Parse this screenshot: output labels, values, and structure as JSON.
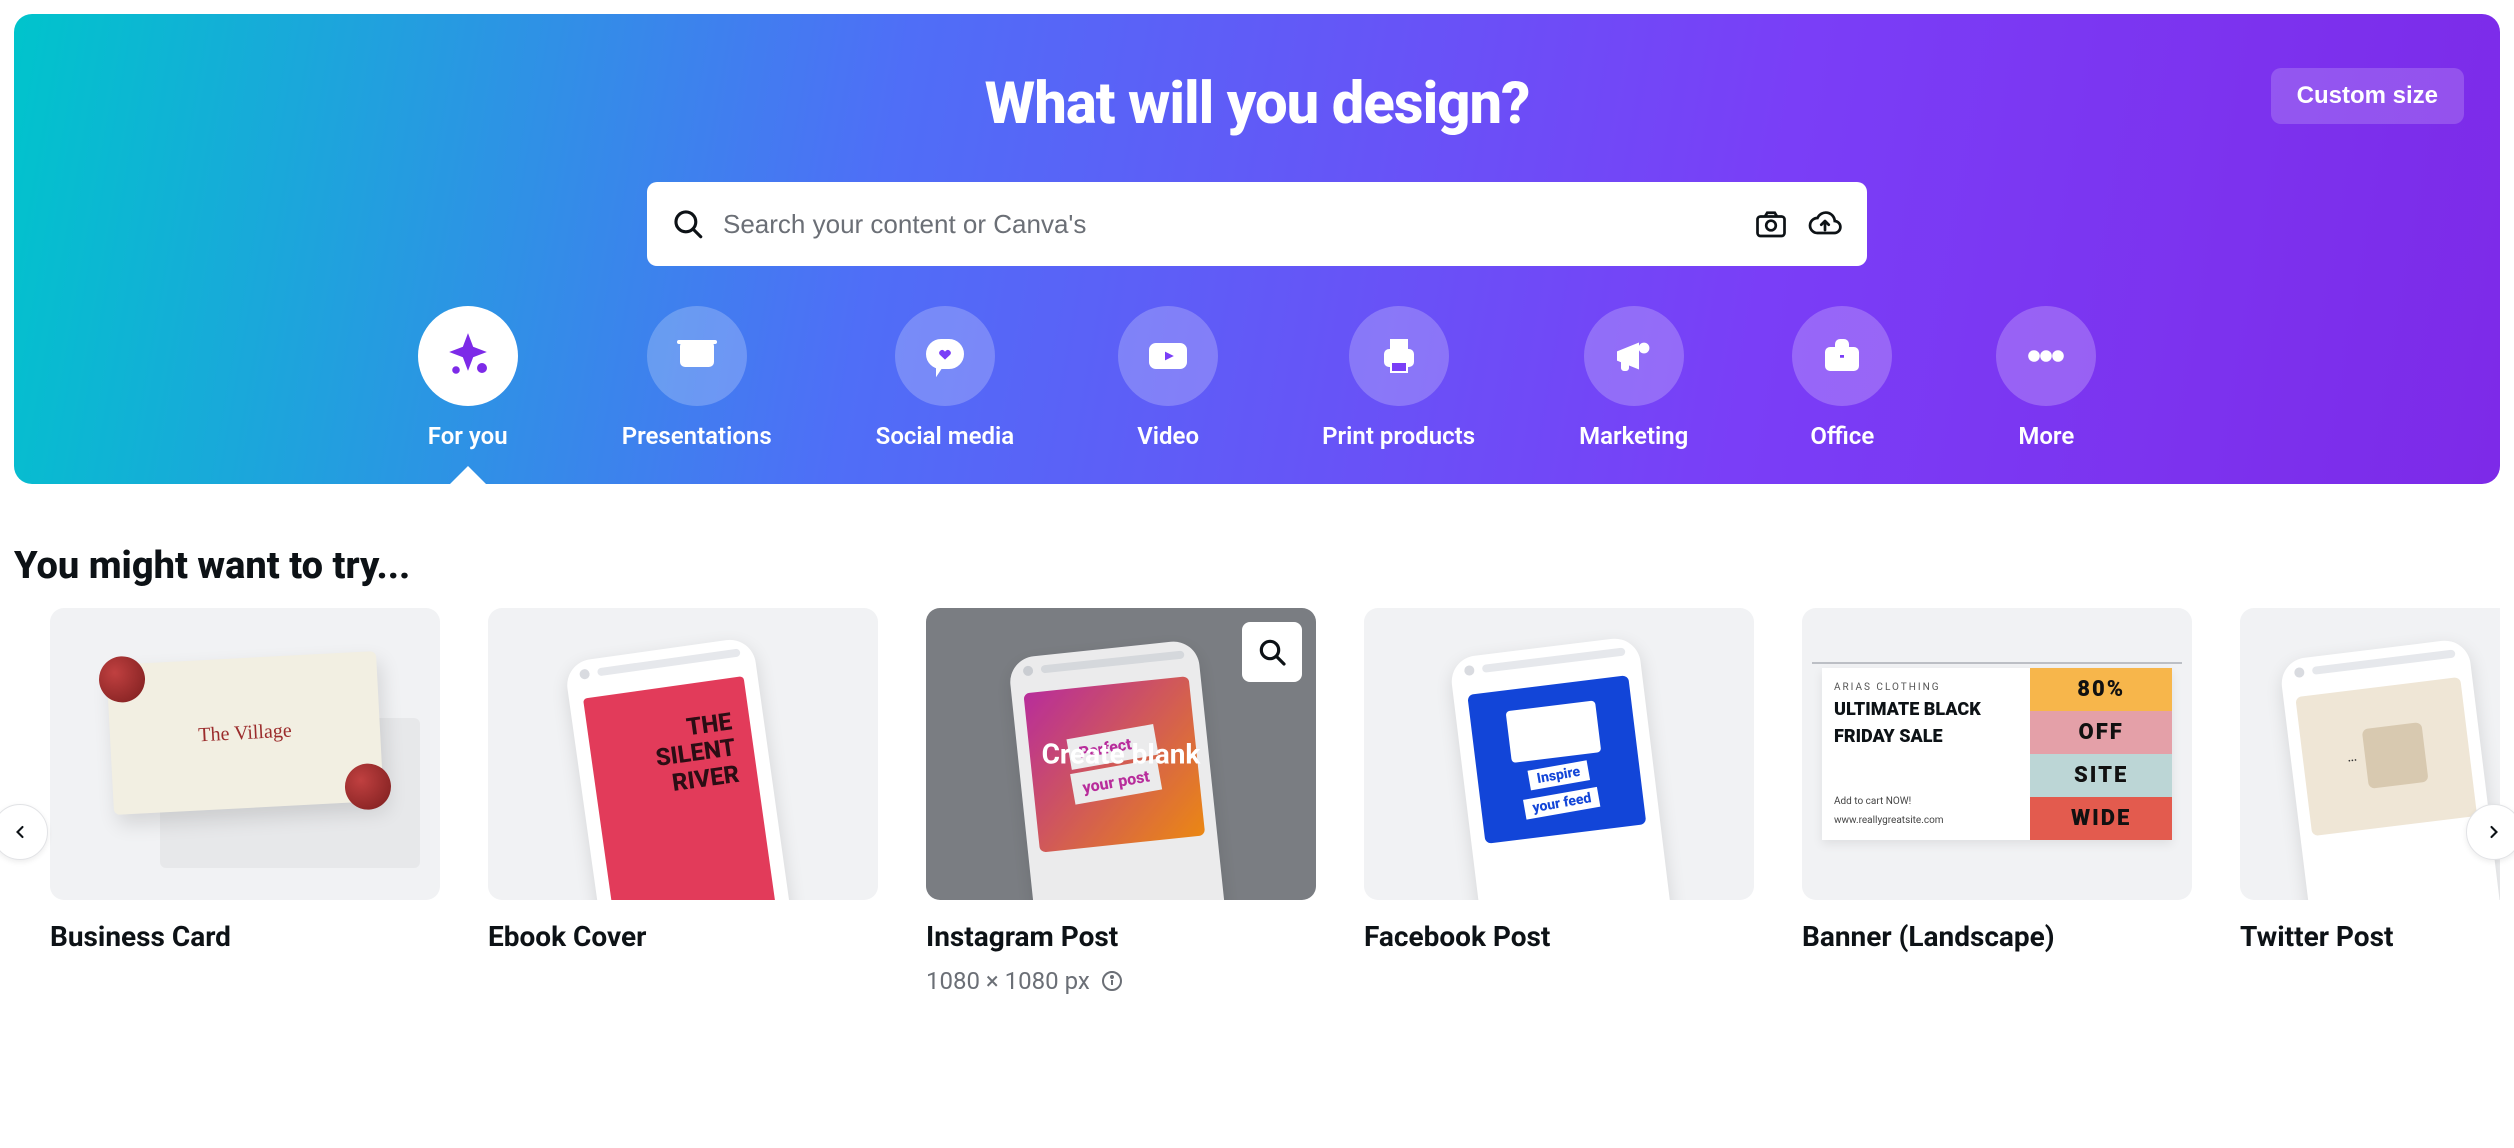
{
  "hero": {
    "title": "What will you design?",
    "custom_size_label": "Custom size",
    "search_placeholder": "Search your content or Canva's"
  },
  "categories": [
    {
      "id": "for-you",
      "label": "For you",
      "icon": "sparkle-icon",
      "active": true
    },
    {
      "id": "presentations",
      "label": "Presentations",
      "icon": "presentation-icon",
      "active": false
    },
    {
      "id": "social-media",
      "label": "Social media",
      "icon": "heart-bubble-icon",
      "active": false
    },
    {
      "id": "video",
      "label": "Video",
      "icon": "video-icon",
      "active": false
    },
    {
      "id": "print-products",
      "label": "Print products",
      "icon": "printer-icon",
      "active": false
    },
    {
      "id": "marketing",
      "label": "Marketing",
      "icon": "megaphone-icon",
      "active": false
    },
    {
      "id": "office",
      "label": "Office",
      "icon": "briefcase-icon",
      "active": false
    },
    {
      "id": "more",
      "label": "More",
      "icon": "more-dots-icon",
      "active": false
    }
  ],
  "suggestions": {
    "heading": "You might want to try...",
    "create_blank_label": "Create blank",
    "cards": [
      {
        "id": "business-card",
        "title": "Business Card",
        "hovered": false
      },
      {
        "id": "ebook-cover",
        "title": "Ebook Cover",
        "hovered": false
      },
      {
        "id": "instagram-post",
        "title": "Instagram Post",
        "hovered": true,
        "dimensions": "1080 × 1080 px"
      },
      {
        "id": "facebook-post",
        "title": "Facebook Post",
        "hovered": false
      },
      {
        "id": "banner-landscape",
        "title": "Banner (Landscape)",
        "hovered": false
      },
      {
        "id": "twitter-post",
        "title": "Twitter Post",
        "hovered": false
      }
    ]
  },
  "mock_text": {
    "bizcard": "The Village",
    "ebook_l1": "THE",
    "ebook_l2": "SILENT",
    "ebook_l3": "RIVER",
    "ig_line1": "Perfect",
    "ig_line2": "your post",
    "fb_line1": "Inspire",
    "fb_line2": "your feed",
    "banner_brand": "ARIAS CLOTHING",
    "banner_big1": "ULTIMATE BLACK",
    "banner_big2": "FRIDAY SALE",
    "banner_small1": "Add to cart NOW!",
    "banner_small2": "www.reallygreatsite.com",
    "banner_r1": "80%",
    "banner_r2": "OFF",
    "banner_r3": "SITE",
    "banner_r4": "WIDE"
  }
}
